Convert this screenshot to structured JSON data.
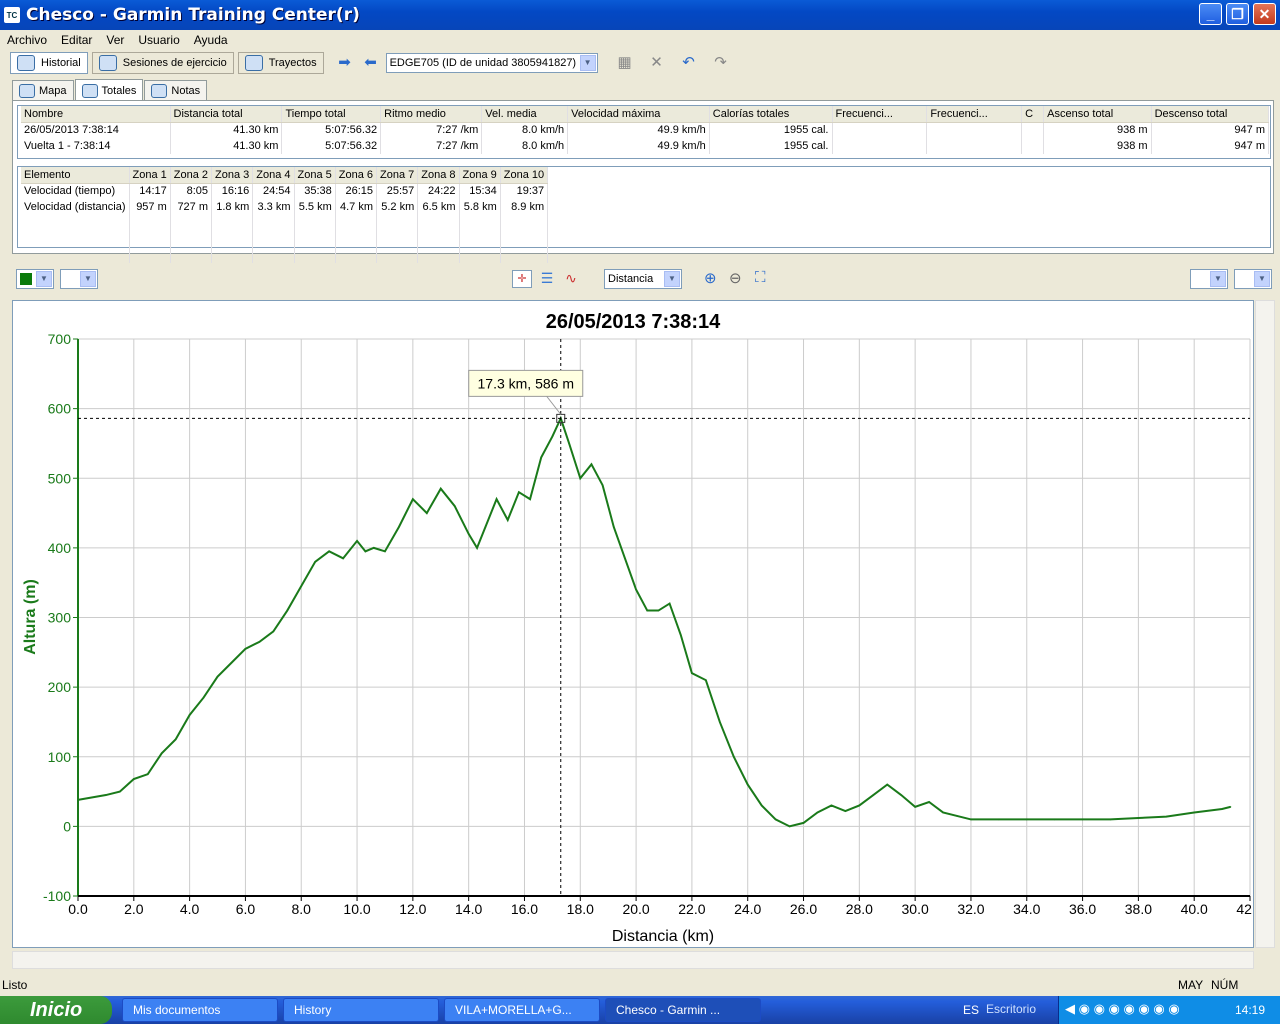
{
  "window": {
    "title": "Chesco - Garmin Training Center(r)",
    "app_icon": "TC"
  },
  "menu": [
    "Archivo",
    "Editar",
    "Ver",
    "Usuario",
    "Ayuda"
  ],
  "toolbar": {
    "historial": "Historial",
    "sesiones": "Sesiones de ejercicio",
    "trayectos": "Trayectos",
    "device": "EDGE705 (ID de unidad 3805941827)"
  },
  "tabs": [
    "Mapa",
    "Totales",
    "Notas"
  ],
  "totals": {
    "headers": [
      "Nombre",
      "Distancia total",
      "Tiempo total",
      "Ritmo medio",
      "Vel. media",
      "Velocidad máxima",
      "Calorías totales",
      "Frecuenci...",
      "Frecuenci...",
      "C",
      "Ascenso total",
      "Descenso total"
    ],
    "rows": [
      [
        "26/05/2013 7:38:14",
        "41.30 km",
        "5:07:56.32",
        "7:27 /km",
        "8.0 km/h",
        "49.9 km/h",
        "1955 cal.",
        "",
        "",
        "",
        "938 m",
        "947 m"
      ],
      [
        "Vuelta 1 - 7:38:14",
        "41.30 km",
        "5:07:56.32",
        "7:27 /km",
        "8.0 km/h",
        "49.9 km/h",
        "1955 cal.",
        "",
        "",
        "",
        "938 m",
        "947 m"
      ]
    ]
  },
  "zones": {
    "headers": [
      "Elemento",
      "Zona 1",
      "Zona 2",
      "Zona 3",
      "Zona 4",
      "Zona 5",
      "Zona 6",
      "Zona 7",
      "Zona 8",
      "Zona 9",
      "Zona 10"
    ],
    "rows": [
      [
        "Velocidad (tiempo)",
        "14:17",
        "8:05",
        "16:16",
        "24:54",
        "35:38",
        "26:15",
        "25:57",
        "24:22",
        "15:34",
        "19:37"
      ],
      [
        "Velocidad (distancia)",
        "957 m",
        "727 m",
        "1.8 km",
        "3.3 km",
        "5.5 km",
        "4.7 km",
        "5.2 km",
        "6.5 km",
        "5.8 km",
        "8.9 km"
      ]
    ]
  },
  "chart_toolbar": {
    "axis_select": "Distancia"
  },
  "chart_data": {
    "type": "line",
    "title": "26/05/2013 7:38:14",
    "xlabel": "Distancia (km)",
    "ylabel": "Altura (m)",
    "xlim": [
      0,
      42
    ],
    "ylim": [
      -100,
      700
    ],
    "xticks": [
      "0.0",
      "2.0",
      "4.0",
      "6.0",
      "8.0",
      "10.0",
      "12.0",
      "14.0",
      "16.0",
      "18.0",
      "20.0",
      "22.0",
      "24.0",
      "26.0",
      "28.0",
      "30.0",
      "32.0",
      "34.0",
      "36.0",
      "38.0",
      "40.0",
      "42.0"
    ],
    "yticks": [
      "700",
      "600",
      "500",
      "400",
      "300",
      "200",
      "100",
      "0",
      "-100"
    ],
    "grid": true,
    "color": "#1a7a1a",
    "series": [
      {
        "x": [
          0,
          1,
          1.5,
          2,
          2.5,
          3,
          3.5,
          4,
          4.5,
          5,
          5.5,
          6,
          6.5,
          7,
          7.5,
          8,
          8.5,
          9,
          9.5,
          10,
          10.3,
          10.6,
          11,
          11.5,
          12,
          12.5,
          13,
          13.5,
          14,
          14.3,
          14.6,
          15,
          15.4,
          15.8,
          16.2,
          16.6,
          17,
          17.3,
          17.6,
          18,
          18.4,
          18.8,
          19.2,
          19.6,
          20,
          20.4,
          20.8,
          21.2,
          21.6,
          22,
          22.5,
          23,
          23.5,
          24,
          24.5,
          25,
          25.5,
          26,
          26.5,
          27,
          27.5,
          28,
          28.5,
          29,
          29.5,
          30,
          30.5,
          31,
          31.5,
          32,
          33,
          34,
          35,
          36,
          37,
          38,
          39,
          40,
          41,
          41.3
        ],
        "y": [
          38,
          45,
          50,
          68,
          75,
          105,
          125,
          160,
          185,
          215,
          235,
          255,
          265,
          280,
          310,
          345,
          380,
          395,
          385,
          410,
          395,
          400,
          395,
          430,
          470,
          450,
          485,
          460,
          420,
          400,
          430,
          470,
          440,
          480,
          470,
          530,
          560,
          586,
          550,
          500,
          520,
          490,
          430,
          385,
          340,
          310,
          310,
          320,
          275,
          220,
          210,
          150,
          100,
          60,
          30,
          10,
          0,
          5,
          20,
          30,
          22,
          30,
          45,
          60,
          45,
          28,
          35,
          20,
          15,
          10,
          10,
          10,
          10,
          10,
          10,
          12,
          14,
          20,
          25,
          28
        ]
      }
    ]
  },
  "status": {
    "left": "Listo",
    "caps": "MAY",
    "num": "NÚM"
  },
  "crosshair": {
    "label": "17.3 km, 586 m",
    "x": 17.3,
    "y": 586
  },
  "taskbar": {
    "start": "Inicio",
    "tasks": [
      "Mis documentos",
      "History",
      "VILA+MORELLA+G...",
      "Chesco - Garmin ..."
    ],
    "lang": "ES",
    "desktop": "Escritorio",
    "clock": "14:19"
  }
}
